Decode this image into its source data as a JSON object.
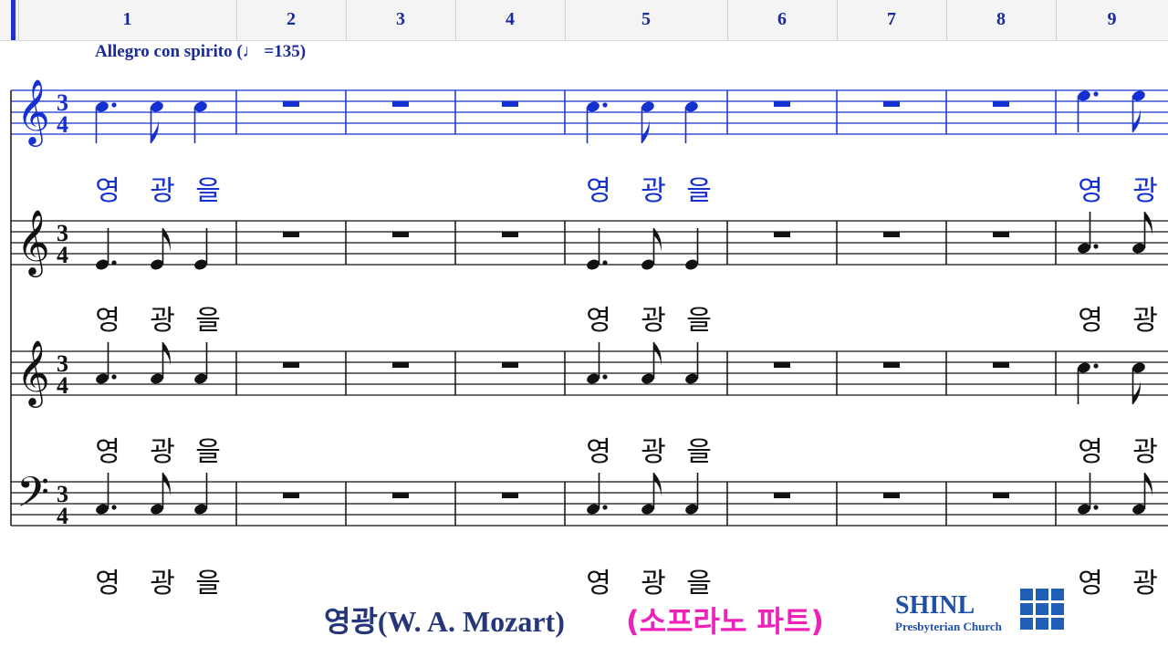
{
  "ruler": {
    "measures": [
      "1",
      "2",
      "3",
      "4",
      "5",
      "6",
      "7",
      "8",
      "9"
    ]
  },
  "tempo": {
    "text": "Allegro con spirito (♩ =135)"
  },
  "staves": [
    {
      "name": "soprano",
      "clef": "treble",
      "time": [
        "3",
        "4"
      ],
      "highlighted": true,
      "lyrics": [
        "영",
        "광",
        "을",
        "영",
        "광",
        "을",
        "영",
        "광"
      ]
    },
    {
      "name": "alto",
      "clef": "treble",
      "time": [
        "3",
        "4"
      ],
      "highlighted": false,
      "lyrics": [
        "영",
        "광",
        "을",
        "영",
        "광",
        "을",
        "영",
        "광"
      ]
    },
    {
      "name": "tenor",
      "clef": "treble",
      "time": [
        "3",
        "4"
      ],
      "highlighted": false,
      "lyrics": [
        "영",
        "광",
        "을",
        "영",
        "광",
        "을",
        "영",
        "광"
      ]
    },
    {
      "name": "bass",
      "clef": "bass",
      "time": [
        "3",
        "4"
      ],
      "highlighted": false,
      "lyrics": [
        "영",
        "광",
        "을",
        "영",
        "광",
        "을",
        "영",
        "광"
      ]
    }
  ],
  "footer": {
    "title": "영광(W. A. Mozart)",
    "part": "(소프라노 파트)"
  },
  "logo": {
    "name": "SHINL",
    "subtitle": "Presbyterian Church"
  },
  "colors": {
    "highlight": "#1530d0",
    "ink": "#111111",
    "title": "#26367a",
    "part": "#ee22b8",
    "logo": "#1f4fa8"
  }
}
